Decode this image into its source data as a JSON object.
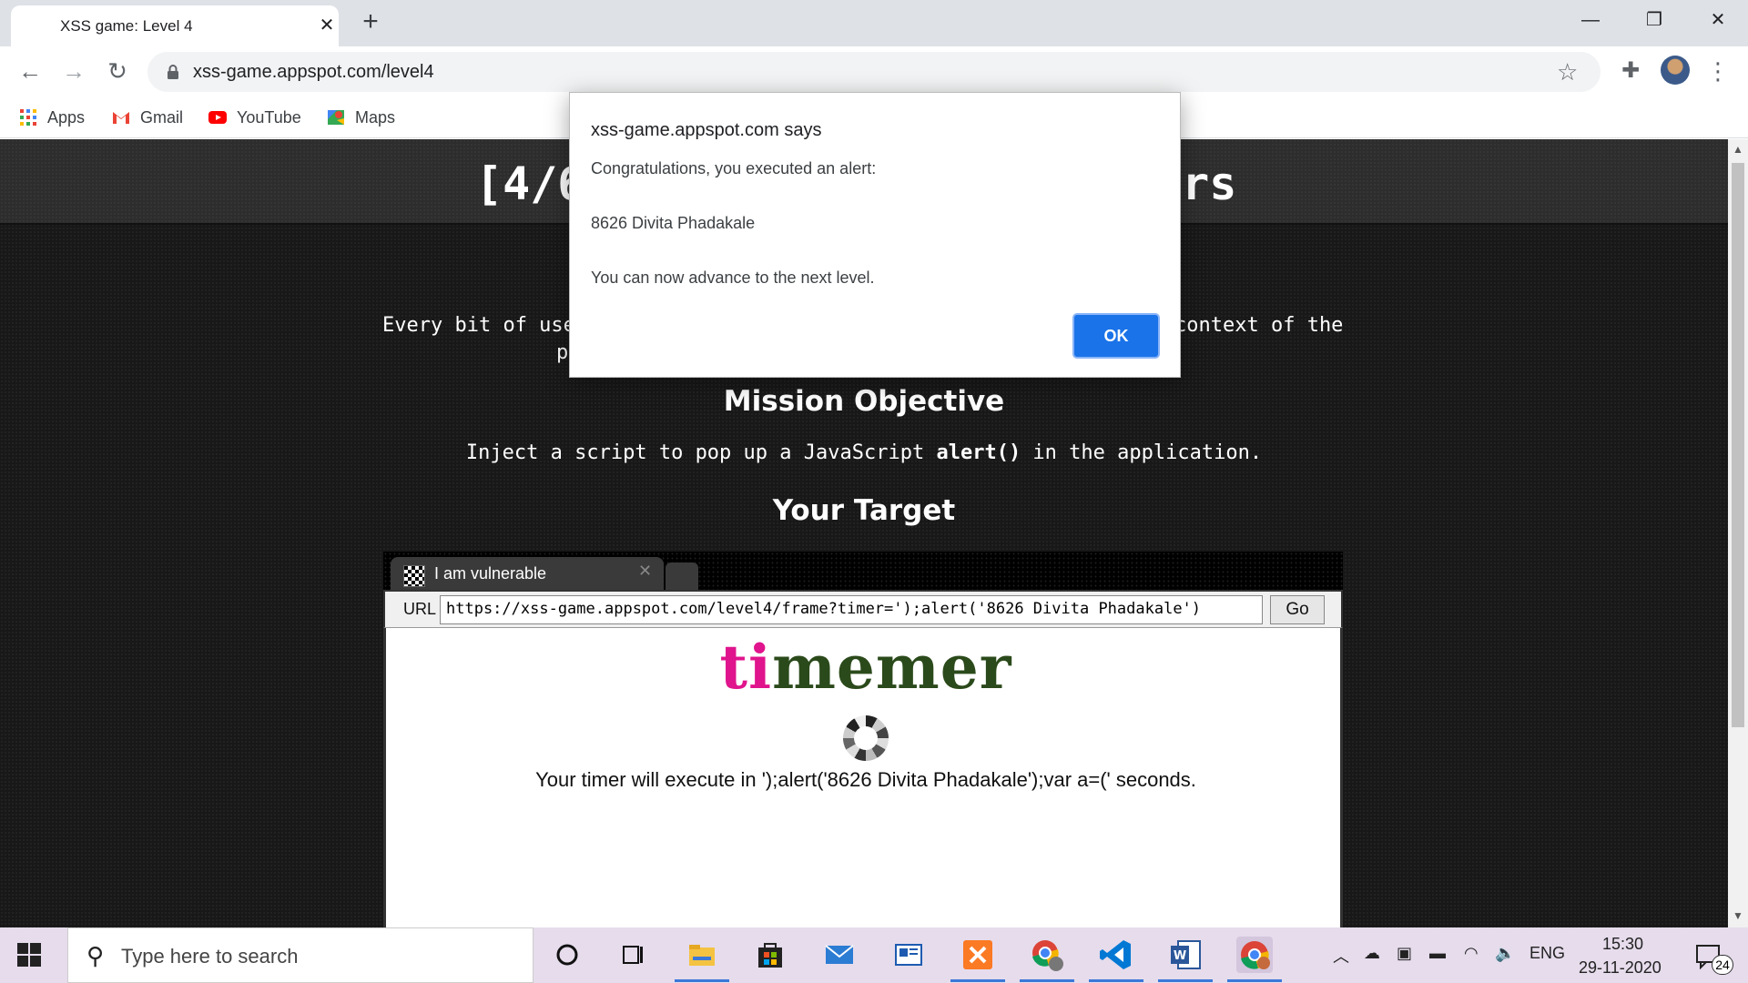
{
  "browser": {
    "tab_title": "XSS game: Level 4",
    "tab_close": "✕",
    "new_tab": "+",
    "window": {
      "minimize": "—",
      "restore": "❐",
      "close": "✕"
    },
    "nav": {
      "back": "←",
      "forward": "→",
      "reload": "↻"
    },
    "url": "xss-game.appspot.com/level4",
    "star": "☆",
    "extensions": "✚",
    "menu": "⋮"
  },
  "bookmarks": [
    {
      "label": "Apps",
      "icon": "apps-grid-icon"
    },
    {
      "label": "Gmail",
      "icon": "gmail-icon"
    },
    {
      "label": "YouTube",
      "icon": "youtube-icon"
    },
    {
      "label": "Maps",
      "icon": "maps-icon"
    }
  ],
  "page": {
    "header_left": "[4/6",
    "header_right": "ers",
    "intro_left": "Every bit of use",
    "intro_right": "context of the",
    "intro_line2": "p",
    "mission_title": "Mission Objective",
    "mission_pre": "Inject a script to pop up a JavaScript ",
    "mission_code": "alert()",
    "mission_post": " in the application.",
    "target_title": "Your Target"
  },
  "target": {
    "tab_title": "I am vulnerable",
    "tab_close": "✕",
    "url_label": "URL",
    "url_value": "https://xss-game.appspot.com/level4/frame?timer=');alert('8626 Divita Phadakale')",
    "go_label": "Go",
    "logo_accent": "ti",
    "logo_rest": "memer",
    "timer_text": "Your timer will execute in ');alert('8626 Divita Phadakale');var a=(' seconds."
  },
  "dialog": {
    "title": "xss-game.appspot.com says",
    "line1": "Congratulations, you executed an alert:",
    "line2": "8626 Divita Phadakale",
    "line3": "You can now advance to the next level.",
    "ok_label": "OK"
  },
  "taskbar": {
    "search_placeholder": "Type here to search",
    "tray_lang": "ENG",
    "time": "15:30",
    "date": "29-11-2020",
    "notifications": "24",
    "apps": [
      "cortana-icon",
      "task-view-icon",
      "file-explorer-icon",
      "store-icon",
      "mail-icon",
      "news-icon",
      "xampp-icon",
      "chrome-s-icon",
      "vscode-icon",
      "word-icon",
      "chrome-icon"
    ]
  },
  "colors": {
    "page_bg": "#181818",
    "dialog_button": "#1a73e8",
    "logo_green": "#2b4a1b",
    "logo_pink": "#e0148c"
  }
}
